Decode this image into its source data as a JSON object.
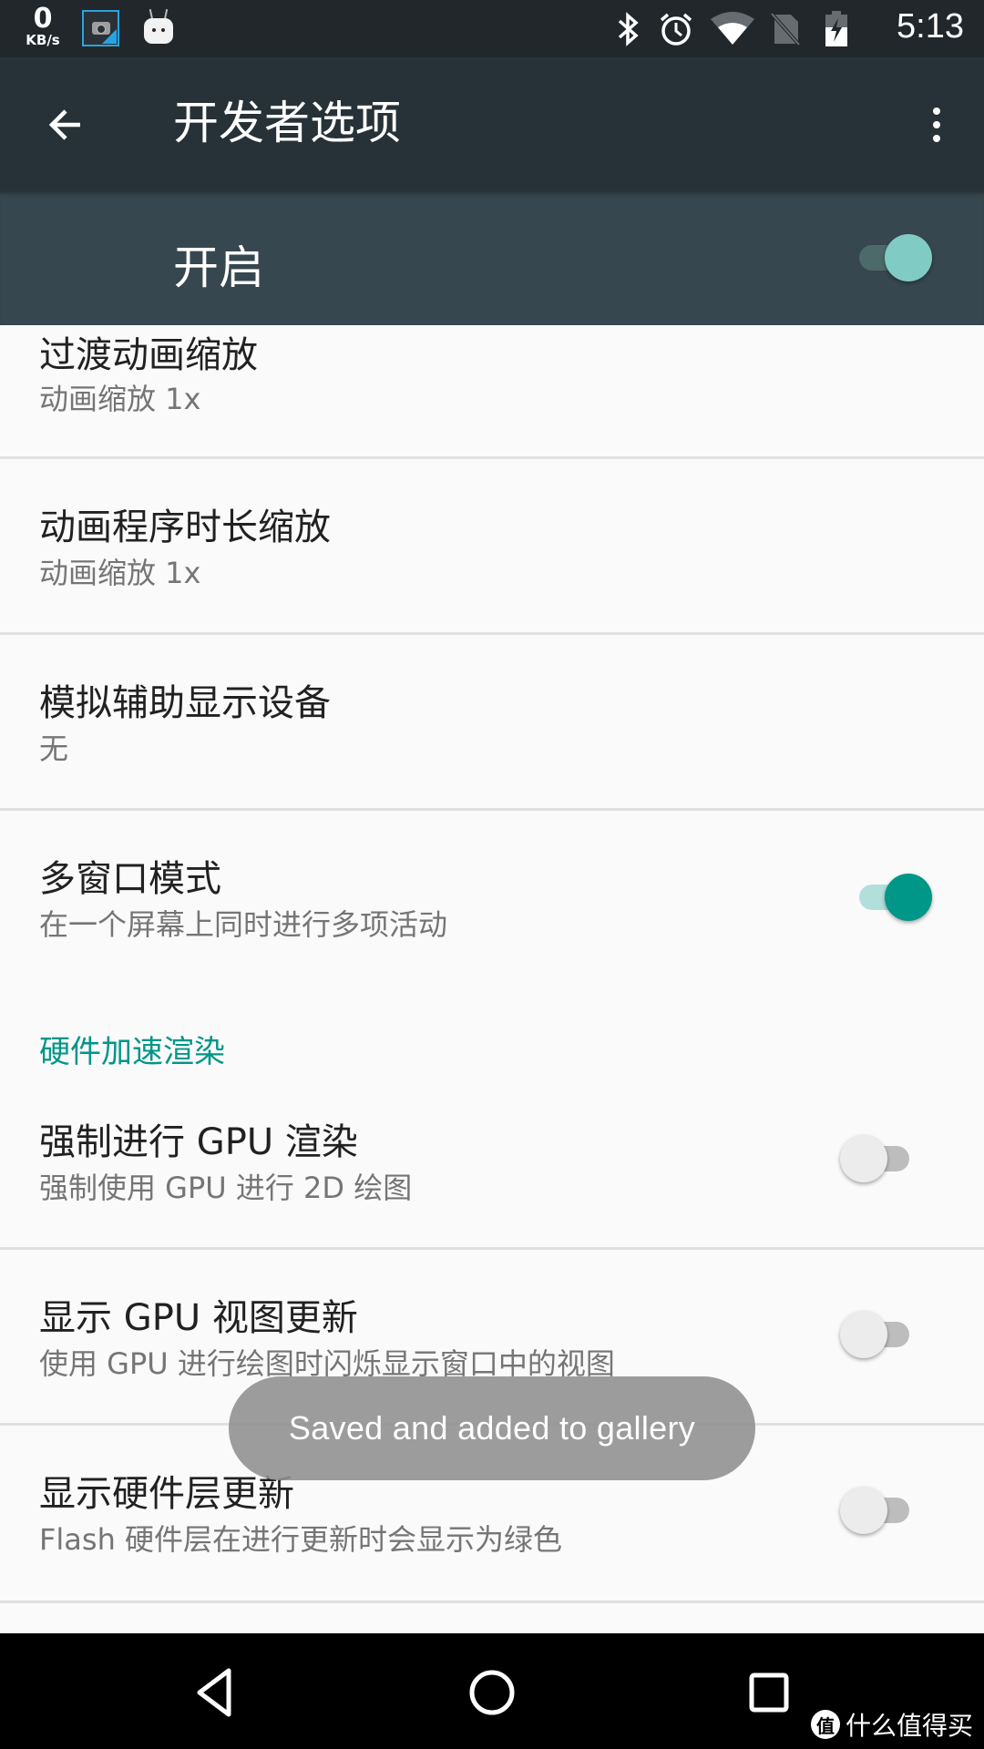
{
  "status_bar": {
    "net_speed_value": "0",
    "net_speed_unit": "KB/s",
    "notifications": [
      "screenshot-icon",
      "android-icon"
    ],
    "system_icons": [
      "bluetooth-icon",
      "alarm-icon",
      "wifi-icon",
      "no-sim-icon",
      "battery-charging-icon"
    ],
    "time": "5:13"
  },
  "app_bar": {
    "title": "开发者选项",
    "back_icon": "arrow-back-icon",
    "menu_icon": "more-vert-icon"
  },
  "master_switch": {
    "label": "开启",
    "checked": true
  },
  "settings": [
    {
      "title": "过渡动画缩放",
      "summary": "动画缩放 1x"
    },
    {
      "title": "动画程序时长缩放",
      "summary": "动画缩放 1x"
    },
    {
      "title": "模拟辅助显示设备",
      "summary": "无"
    },
    {
      "title": "多窗口模式",
      "summary": "在一个屏幕上同时进行多项活动",
      "checked": true
    }
  ],
  "category": {
    "label": "硬件加速渲染"
  },
  "hw_settings": [
    {
      "title": "强制进行 GPU 渲染",
      "summary": "强制使用 GPU 进行 2D 绘图",
      "checked": false
    },
    {
      "title": "显示 GPU 视图更新",
      "summary": "使用 GPU 进行绘图时闪烁显示窗口中的视图",
      "checked": false
    },
    {
      "title": "显示硬件层更新",
      "summary": "Flash 硬件层在进行更新时会显示为绿色",
      "checked": false
    }
  ],
  "toast": {
    "message": "Saved and added to gallery"
  },
  "nav_bar": {
    "buttons": [
      "back-icon",
      "home-icon",
      "recents-icon"
    ]
  },
  "watermark": {
    "badge": "值",
    "text": "什么值得买"
  },
  "colors": {
    "status_bar": "#21272b",
    "app_bar": "#263238",
    "master_bar": "#37474f",
    "accent": "#009688",
    "background": "#fafafa"
  }
}
